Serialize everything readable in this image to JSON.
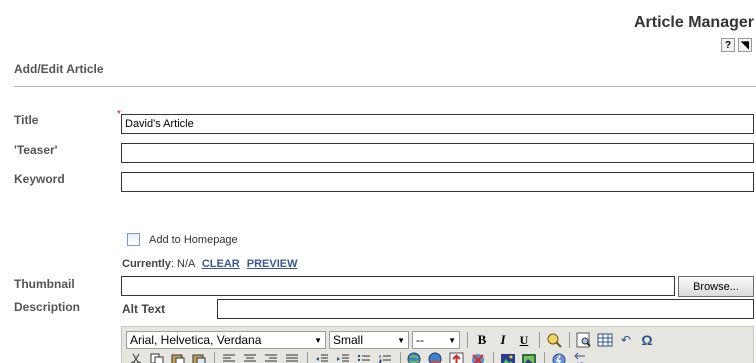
{
  "header": {
    "app_title": "Article Manager",
    "help_icon": "?",
    "pointer_icon": "◥"
  },
  "section": {
    "title": "Add/Edit Article"
  },
  "form": {
    "title_label": "Title",
    "title_value": "David's Article",
    "required_marker": "*",
    "teaser_label": "'Teaser'",
    "teaser_value": "",
    "keyword_label": "Keyword",
    "keyword_value": "",
    "homepage_label": "Add to Homepage",
    "homepage_checked": false,
    "thumbnail_label": "Thumbnail",
    "currently_label": "Currently",
    "currently_value": ": N/A",
    "clear_link": "CLEAR",
    "preview_link": "PREVIEW",
    "thumbnail_value": "",
    "browse_label": "Browse...",
    "alt_text_label": "Alt Text",
    "alt_text_value": "",
    "description_label": "Description"
  },
  "editor": {
    "font_select": "Arial, Helvetica, Verdana",
    "size_select": "Small",
    "format_select": "--",
    "bold": "B",
    "italic": "I",
    "underline": "U",
    "undo_glyph": "↶",
    "omega_glyph": "Ω"
  }
}
